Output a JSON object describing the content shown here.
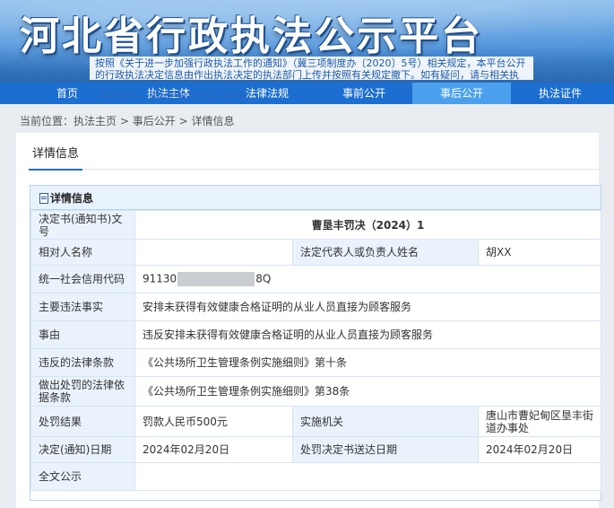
{
  "banner": {
    "title": "河北省行政执法公示平台",
    "notice": "按照《关于进一步加强行政执法工作的通知》（冀三项制度办〔2020〕5号）相关规定，本平台公开的行政执法决定信息由作出执法决定的执法部门上传并按照有关规定撤下。如有疑问，请与相关执法部门联系。"
  },
  "nav": {
    "items": [
      {
        "label": "首页"
      },
      {
        "label": "执法主体"
      },
      {
        "label": "法律法规"
      },
      {
        "label": "事前公开"
      },
      {
        "label": "事后公开"
      },
      {
        "label": "执法证件"
      }
    ],
    "overlay_text": "如有疑问，请与相关执法部门联系。"
  },
  "breadcrumb": {
    "prefix": "当前位置：",
    "items": [
      "执法主页",
      "事后公开",
      "详情信息"
    ],
    "separator": ">"
  },
  "tab": {
    "label": "详情信息"
  },
  "panel": {
    "title": "详情信息"
  },
  "detail": {
    "decision_no_label": "决定书(通知书)文号",
    "decision_no": "曹垦丰罚决（2024）1",
    "party_label": "相对人名称",
    "party": "",
    "legal_rep_label": "法定代表人或负责人姓名",
    "legal_rep": "胡XX",
    "credit_code_label": "统一社会信用代码",
    "credit_code_prefix": "91130",
    "credit_code_suffix": "8Q",
    "violation_label": "主要违法事实",
    "violation": "安排未获得有效健康合格证明的从业人员直接为顾客服务",
    "cause_label": "事由",
    "cause": "违反安排未获得有效健康合格证明的从业人员直接为顾客服务",
    "violated_law_label": "违反的法律条款",
    "violated_law": "《公共场所卫生管理条例实施细则》第十条",
    "penalty_basis_label": "做出处罚的法律依据条款",
    "penalty_basis": "《公共场所卫生管理条例实施细则》第38条",
    "result_label": "处罚结果",
    "result": "罚款人民币500元",
    "authority_label": "实施机关",
    "authority": "唐山市曹妃甸区垦丰街道办事处",
    "decision_date_label": "决定(通知)日期",
    "decision_date": "2024年02月20日",
    "delivery_date_label": "处罚决定书送达日期",
    "delivery_date": "2024年02月20日",
    "fulltext_label": "全文公示",
    "fulltext": ""
  },
  "colors": {
    "nav_bg": "#1c6fd0",
    "nav_active": "#4aa0ec",
    "label_bg": "#eaf3fc",
    "border": "#d6e4f3"
  }
}
